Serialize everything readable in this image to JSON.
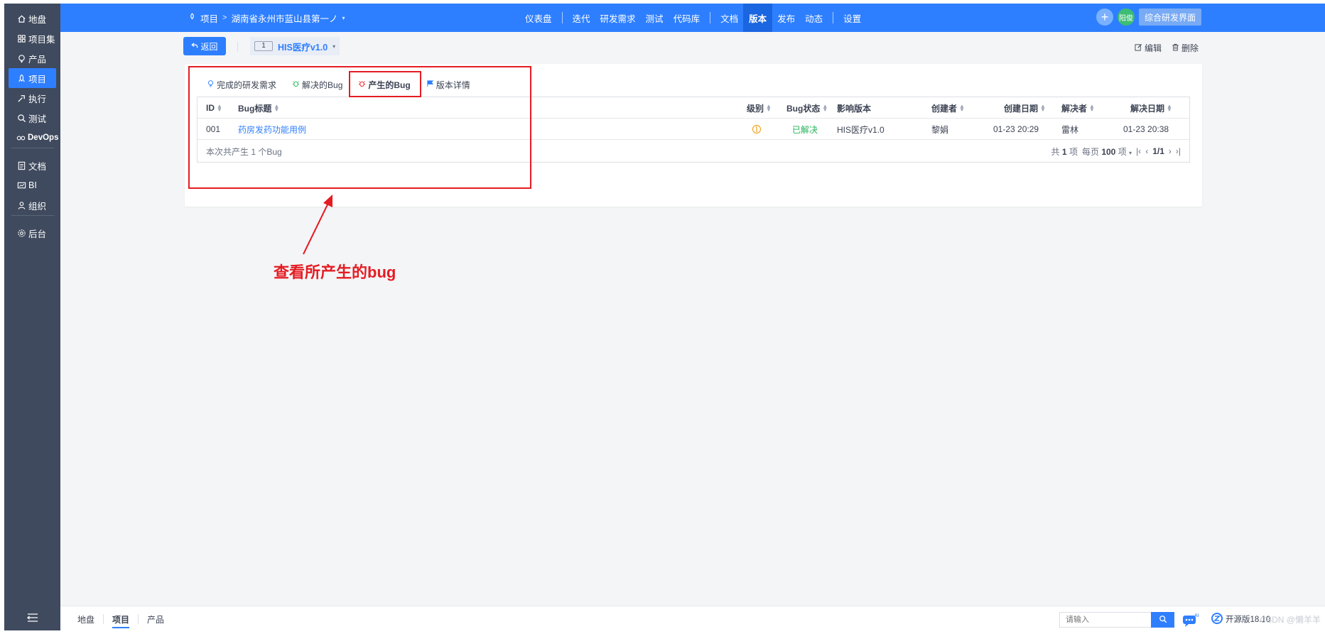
{
  "sidebar": {
    "items": [
      {
        "label": "地盘",
        "icon": "home-icon"
      },
      {
        "label": "项目集",
        "icon": "grid-icon"
      },
      {
        "label": "产品",
        "icon": "lightbulb-icon"
      },
      {
        "label": "项目",
        "icon": "project-icon",
        "active": true
      },
      {
        "label": "执行",
        "icon": "run-icon"
      },
      {
        "label": "测试",
        "icon": "search-icon"
      },
      {
        "label": "DevOps",
        "icon": "infinity-icon"
      },
      {
        "label": "文档",
        "icon": "doc-icon"
      },
      {
        "label": "BI",
        "icon": "chart-icon"
      },
      {
        "label": "组织",
        "icon": "org-icon"
      },
      {
        "label": "后台",
        "icon": "gear-icon"
      }
    ]
  },
  "header": {
    "breadcrumb_root": "项目",
    "breadcrumb_project": "湖南省永州市蓝山县第一ノ",
    "nav": [
      {
        "label": "仪表盘"
      },
      {
        "label": "迭代"
      },
      {
        "label": "研发需求"
      },
      {
        "label": "测试"
      },
      {
        "label": "代码库"
      },
      {
        "label": "文档"
      },
      {
        "label": "版本",
        "active": true
      },
      {
        "label": "发布"
      },
      {
        "label": "动态"
      },
      {
        "label": "设置"
      }
    ],
    "avatar_text": "阳俊",
    "plus_symbol": "+",
    "switch_button": "综合研发界面"
  },
  "toolbar": {
    "back_label": "返回",
    "build_number": "1",
    "build_name": "HIS医疗v1.0",
    "edit_label": "编辑",
    "delete_label": "删除"
  },
  "tabs": [
    {
      "label": "完成的研发需求",
      "icon": "lightbulb-icon"
    },
    {
      "label": "解决的Bug",
      "icon": "bug-icon"
    },
    {
      "label": "产生的Bug",
      "icon": "bug-icon",
      "active": true
    },
    {
      "label": "版本详情",
      "icon": "flag-icon"
    }
  ],
  "table": {
    "columns": [
      "ID",
      "Bug标题",
      "级别",
      "Bug状态",
      "影响版本",
      "创建者",
      "创建日期",
      "解决者",
      "解决日期"
    ],
    "rows": [
      {
        "id": "001",
        "title": "药房发药功能用例",
        "severity_icon": "severity-icon",
        "status": "已解决",
        "affected_build": "HIS医疗v1.0",
        "creator": "黎娟",
        "created": "01-23 20:29",
        "resolver": "雷林",
        "resolved": "01-23 20:38"
      }
    ],
    "summary": "本次共产生 1 个Bug",
    "pager": {
      "total_prefix": "共",
      "total": "1",
      "total_suffix": "项",
      "per_page_prefix": "每页",
      "per_page": "100",
      "per_page_suffix": "项",
      "page": "1/1"
    }
  },
  "annotation": {
    "text": "查看所产生的bug",
    "color": "#e51c23"
  },
  "footer": {
    "crumbs": [
      {
        "label": "地盘"
      },
      {
        "label": "项目",
        "active": true
      },
      {
        "label": "产品"
      }
    ],
    "search_placeholder": "请输入",
    "version": "开源版18.10",
    "watermark": "CSDN @懒羊羊"
  },
  "colors": {
    "primary": "#2e7fff",
    "sidebar": "#3f4a5e",
    "success": "#25b35a"
  }
}
